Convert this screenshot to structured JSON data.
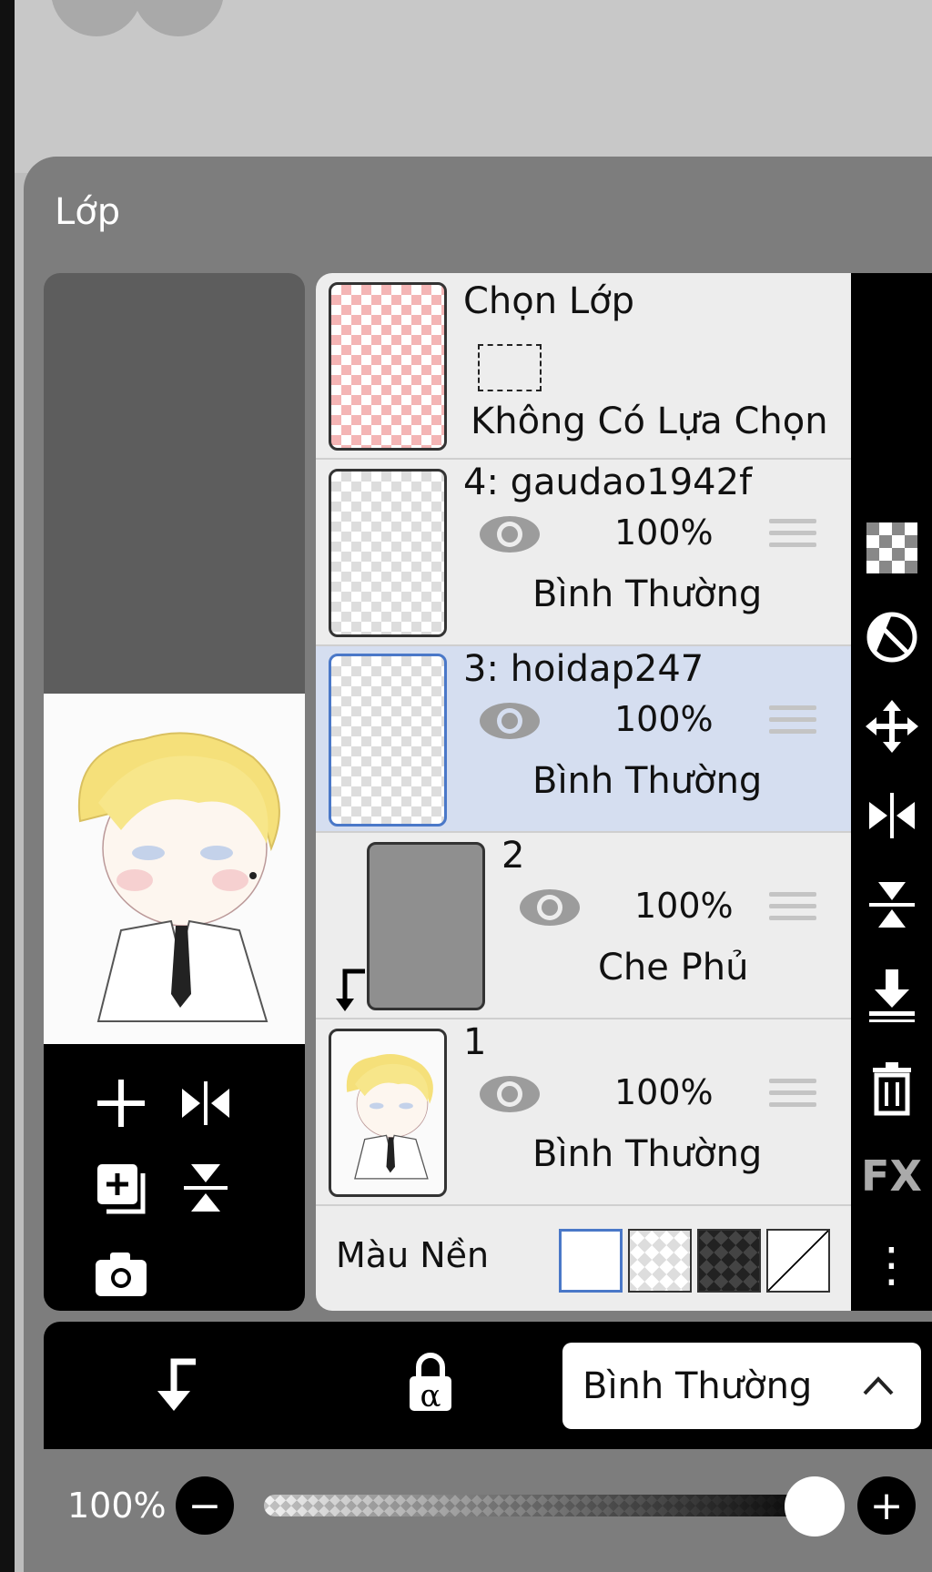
{
  "panel": {
    "title": "Lớp"
  },
  "selection_layer": {
    "title": "Chọn Lớp",
    "status": "Không Có Lựa Chọn"
  },
  "layers": [
    {
      "name": "4: gaudao1942f",
      "opacity": "100%",
      "blend": "Bình Thường",
      "visible": true,
      "selected": false
    },
    {
      "name": "3: hoidap247",
      "opacity": "100%",
      "blend": "Bình Thường",
      "visible": true,
      "selected": true
    },
    {
      "name": "2",
      "opacity": "100%",
      "blend": "Che Phủ",
      "visible": true,
      "selected": false,
      "clipping": true
    },
    {
      "name": "1",
      "opacity": "100%",
      "blend": "Bình Thường",
      "visible": true,
      "selected": false
    }
  ],
  "background": {
    "label": "Màu Nền"
  },
  "right_toolbar": {
    "items": [
      "checker-icon",
      "invert-icon",
      "move-icon",
      "flip-horizontal-icon",
      "flip-vertical-icon",
      "merge-down-icon",
      "trash-icon",
      "fx-icon",
      "more-icon"
    ],
    "fx_label": "FX",
    "more_label": "⋮"
  },
  "bottom_bar": {
    "blend_mode": "Bình Thường",
    "alpha_label": "α"
  },
  "slider": {
    "value_label": "100%",
    "value": 100,
    "minus_label": "−",
    "plus_label": "+"
  },
  "colors": {
    "accent": "#4a78c8",
    "selected_row": "#d5def0",
    "panel": "#7d7d7d"
  }
}
